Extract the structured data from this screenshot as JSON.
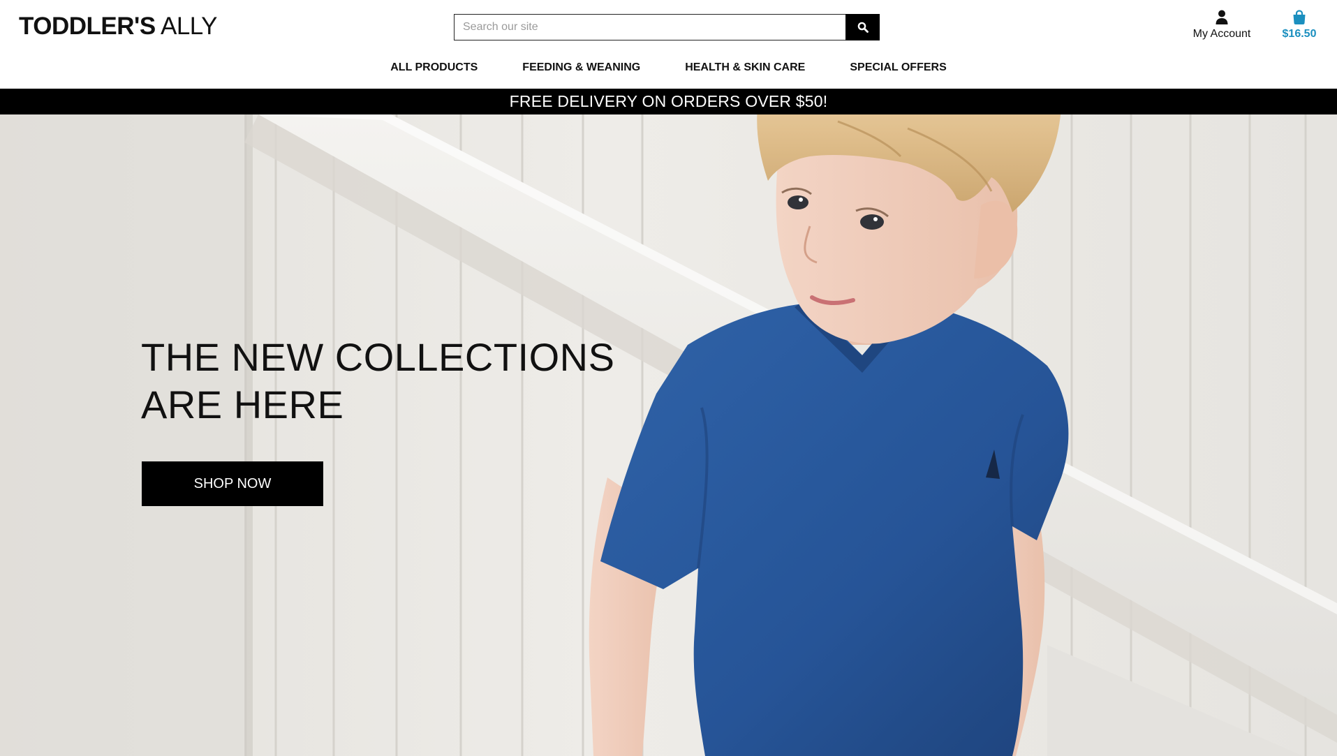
{
  "header": {
    "logo_bold": "TODDLER'S",
    "logo_light": "ALLY",
    "search": {
      "placeholder": "Search our site",
      "value": ""
    },
    "account": {
      "label": "My Account",
      "icon": "user-icon"
    },
    "bag": {
      "total": "$16.50",
      "icon": "shopping-bag-icon"
    },
    "nav": [
      {
        "label": "ALL PRODUCTS"
      },
      {
        "label": "FEEDING & WEANING"
      },
      {
        "label": "HEALTH & SKIN CARE"
      },
      {
        "label": "SPECIAL OFFERS"
      }
    ]
  },
  "banner": {
    "text": "FREE DELIVERY ON ORDERS OVER $50!"
  },
  "hero": {
    "title_line1": "THE NEW COLLECTIONS",
    "title_line2": "ARE HERE",
    "cta": "SHOP NOW"
  },
  "colors": {
    "accent": "#1b8fbf",
    "banner_bg": "#000000",
    "button_bg": "#000000",
    "shirt": "#1f4f94",
    "wall": "#e9e7e2"
  }
}
